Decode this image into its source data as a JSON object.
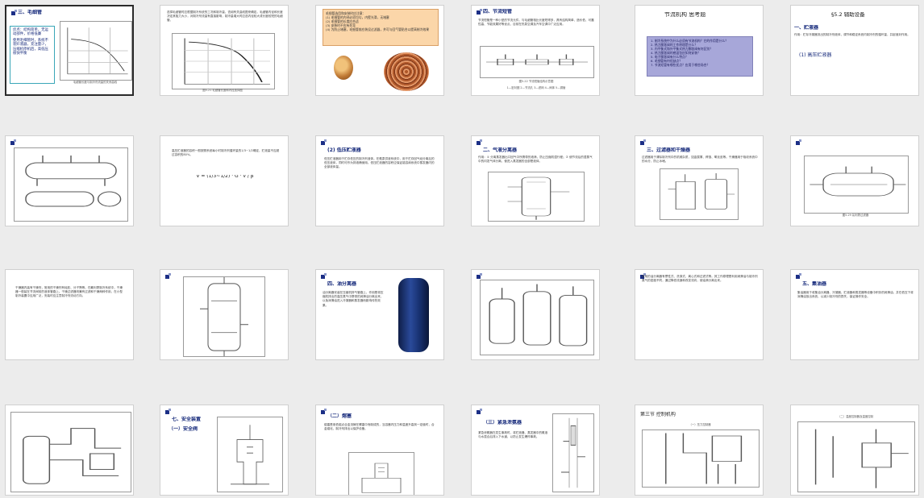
{
  "slides": [
    {
      "id": 1,
      "title": "三、毛细管",
      "selected": true,
      "bullets": [
        "优点：结构简单，无运动部件，价格低廉",
        "使用毛细管时，系统不装贮液器，充注量少，压缩机停机后，高低压很快平衡"
      ],
      "caption": "毛细管长度与制冷剂流量的关系曲线"
    },
    {
      "id": 2,
      "title": "",
      "text": "选择毛细管时应根据制冷系统的工况和制冷量，查阅有关曲线图来确定。毛细管内径和长度决定其阻力大小，对制冷剂流量有直接影响，制冷量增大时应选内径较大或长度较短的毛细管。",
      "caption": "图5-21 毛细管长度和内径选择图"
    },
    {
      "id": 3,
      "title": "",
      "notes": [
        "毛细管选用和安装时应注意：",
        "(1) 毛细管的内径必须均匀，内壁光滑，无堵塞",
        "(2) 毛细管的长度应合适",
        "(3) 安装时不应有死弯",
        "(4) 为防止堵塞，毛细管前应装设过滤器，并可与回气管贴合以提高制冷效果"
      ]
    },
    {
      "id": 4,
      "title": "四、节流短管",
      "text": "节流短管是一种小型的节流元件，与毛细管相比长度短得多，具有结构简单、造价低、可靠性高、节能效果好等优点，目前在热泵空调及汽车空调中广泛应用。",
      "caption": "图5-22 节流短管结构示意图",
      "legend": "1—密封圈 2—节流孔 3—滤网 4—阀体 5—铜管"
    },
    {
      "id": 5,
      "title": "节流机构 思考题",
      "questions": [
        "1. 制冷系统中为什么必须有节流机构？它的作用是什么？",
        "2. 热力膨胀阀的工作原理是什么？",
        "3. 内平衡式和外平衡式热力膨胀阀有何区别？",
        "4. 热力膨胀阀的感温包应如何安装？",
        "5. 电子膨胀阀有什么特点？",
        "6. 毛细管有何优缺点？",
        "7. 节流短管有哪些优点？应用于哪些场合？"
      ]
    },
    {
      "id": 6,
      "title": "§5.2 辅助设备",
      "subtitle": "一、贮液器",
      "text": "作用：贮存冷凝器流出的制冷剂液体，调节和稳定系统内制冷剂的循环量，并起液封作用。",
      "item": "(1) 高压贮液器"
    },
    {
      "id": 7,
      "title": "",
      "caption": "卧式贮液器结构图"
    },
    {
      "id": 8,
      "title": "",
      "text": "高压贮液器的容积一般按照系统每小时制冷剂循环量的1/3~1/2确定，贮液量不应超过容积的80%。",
      "formula": "V = (1/3~1/2) · G · v / β"
    },
    {
      "id": 9,
      "title": "(2) 低压贮液器",
      "text": "低压贮液器用于贮存低压的制冷剂液体。在氨泵供液系统中，用于贮存回气经分离后的低压液体，同时可作为排液桶使用。低压贮液器的容积应保证能容纳系统中蒸发器内的全部液体量。"
    },
    {
      "id": 10,
      "title": "二、气液分离器",
      "text": "作用：① 分离蒸发器出口回气中所携带的液滴，防止压缩机湿行程；② 使节流后的湿蒸气中的闪发气体分离，使进入蒸发器的全部是液体。",
      "caption": "图5-25 立式气液分离器"
    },
    {
      "id": 11,
      "title": "三、过滤器和干燥器",
      "text": "过滤器用于清除制冷剂中的机械杂质，如金属屑、焊渣、氧化皮等。干燥器用于吸收系统中的水分，防止冰堵。",
      "caption": "图5-26 过滤器"
    },
    {
      "id": 12,
      "title": "",
      "caption": "图5-29 氟利昂过滤器"
    },
    {
      "id": 13,
      "title": "",
      "text": "干燥器内装有干燥剂，常用的干燥剂有硅胶、分子筛等。在氟利昂制冷系统中，干燥器一般装在节流阀前的液体管路上。干燥过滤器则兼有过滤和干燥两种作用，在小型制冷装置中应用广泛，安装时应注意制冷剂流动方向。"
    },
    {
      "id": 14,
      "title": "",
      "caption": "图5-30 干燥过滤器"
    },
    {
      "id": 15,
      "title": "四、油分离器",
      "text": "油分离器安装在压缩机排气管路上，作用是将压缩机排出的高压蒸气中携带的润滑油分离出来，以免润滑油进入冷凝器和蒸发器而影响传热效果。"
    },
    {
      "id": 16,
      "title": "",
      "caption": "图5-31 各种油分离器结构"
    },
    {
      "id": 17,
      "title": "",
      "text": "常用的油分离器有惯性式、洗涤式、离心式和过滤式等。其工作原理是利用润滑油与制冷剂蒸气的密度不同，通过降低流速和改变流向，使油滴分离出来。"
    },
    {
      "id": 18,
      "title": "五、集油器",
      "text": "集油器用于收集油分离器、冷凝器、贮液器和蒸发器等设备中积存的润滑油，并在低压下将润滑油放出系统，以减少制冷剂的损失，保证操作安全。"
    },
    {
      "id": 19,
      "title": "",
      "caption": "图5-32 集油器及其接管示意图"
    },
    {
      "id": 20,
      "title": "七、安全装置",
      "subtitle": "（一）安全阀",
      "caption": "图5-33 安全阀"
    },
    {
      "id": 21,
      "title": "（二）熔塞",
      "text": "熔塞是用低熔点合金浇铸在螺塞中而制成的，当容器内压力和温度升高到一定值时，合金熔化，制冷剂排出以保护设备。",
      "caption": "熔塞结构"
    },
    {
      "id": 22,
      "title": "（三）紧急泄氨器",
      "text": "紧急泄氨器在发生事故时，将贮液器、蒸发器中的氨液与水混合后排入下水道，以防止发生爆炸事故。",
      "caption": "紧急泄氨器"
    },
    {
      "id": 23,
      "title": "第三节 控制机构",
      "subtitle": "（一）压力控制器",
      "caption": "压力控制器结构图"
    },
    {
      "id": 24,
      "title": "（二）温度控制器及温度控制",
      "caption": "温度控制器结构示意图"
    }
  ]
}
